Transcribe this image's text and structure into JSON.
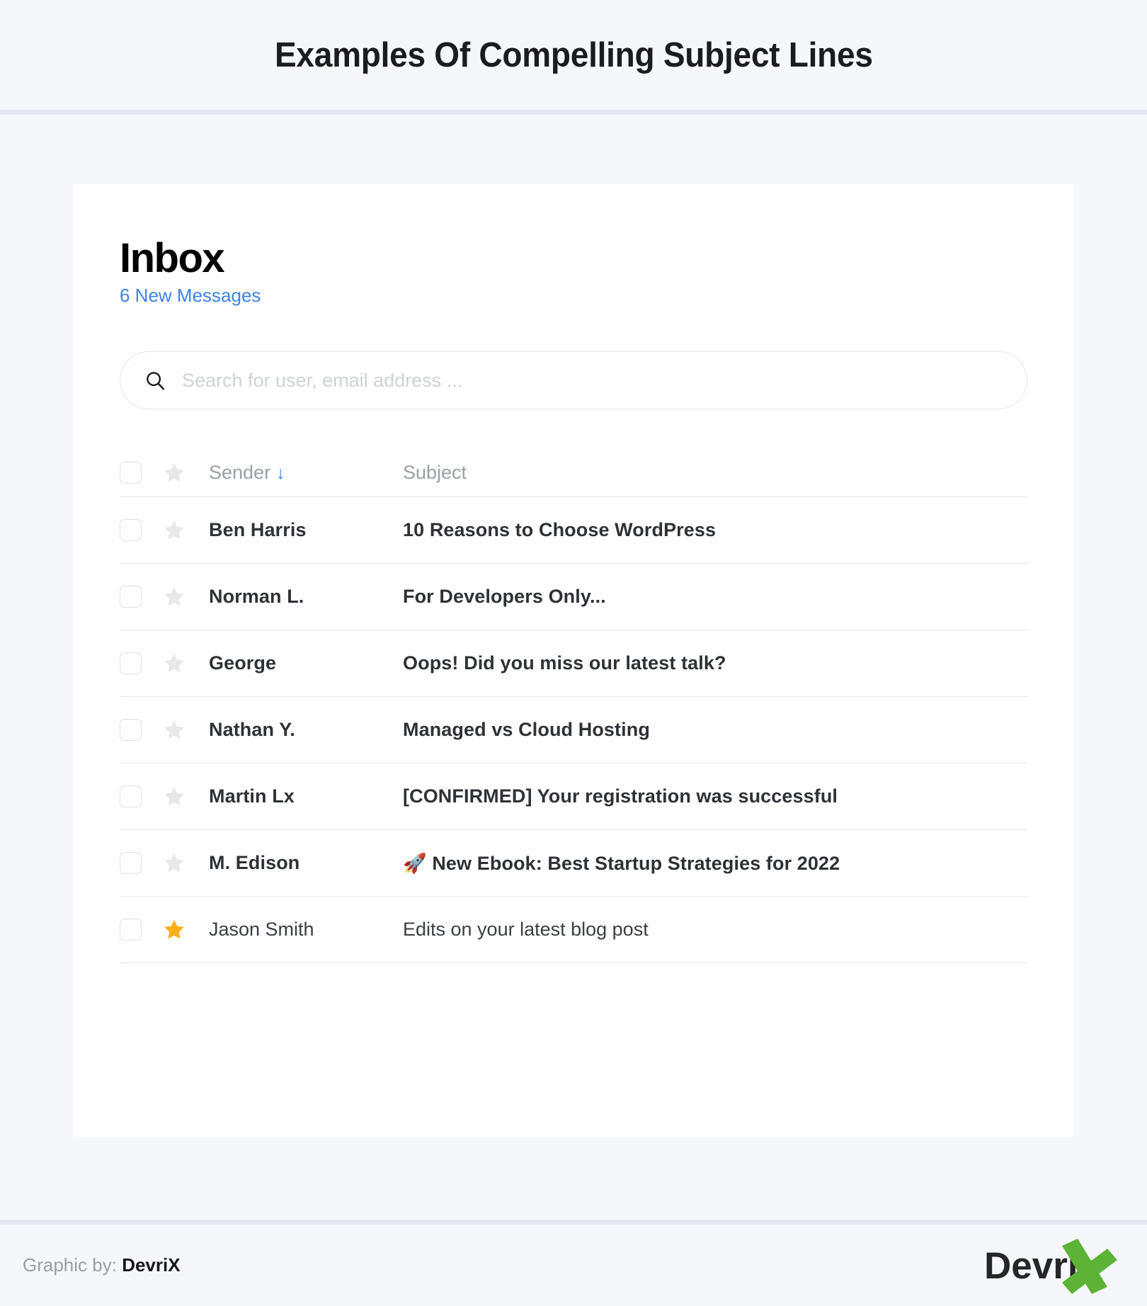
{
  "header": {
    "title": "Examples Of Compelling Subject Lines"
  },
  "inbox": {
    "heading": "Inbox",
    "new_messages": "6 New Messages",
    "accent_color": "#3d83e4"
  },
  "search": {
    "placeholder": "Search for user, email address ...",
    "value": "",
    "icon": "search-icon"
  },
  "table": {
    "columns": {
      "select_all": "",
      "star": "star-icon",
      "sender": "Sender",
      "sort_indicator": "↓",
      "subject": "Subject"
    },
    "rows": [
      {
        "sender": "Ben Harris",
        "subject": "10 Reasons to Choose WordPress",
        "starred": false,
        "unread": true,
        "checked": false
      },
      {
        "sender": "Norman L.",
        "subject": "For Developers Only...",
        "starred": false,
        "unread": true,
        "checked": false
      },
      {
        "sender": "George",
        "subject": "Oops! Did you miss our latest talk?",
        "starred": false,
        "unread": true,
        "checked": false
      },
      {
        "sender": "Nathan Y.",
        "subject": "Managed vs Cloud Hosting",
        "starred": false,
        "unread": true,
        "checked": false
      },
      {
        "sender": "Martin Lx",
        "subject": "[CONFIRMED] Your registration was successful",
        "starred": false,
        "unread": true,
        "checked": false
      },
      {
        "sender": "M. Edison",
        "subject": "🚀 New Ebook: Best Startup Strategies for 2022",
        "starred": false,
        "unread": true,
        "checked": false
      },
      {
        "sender": "Jason Smith",
        "subject": "Edits on your latest blog post",
        "starred": true,
        "unread": false,
        "checked": false
      }
    ]
  },
  "footer": {
    "credit_prefix": "Graphic by:",
    "credit_brand": "DevriX",
    "logo_text": "Devri",
    "logo_mark": "X",
    "logo_mark_color": "#5cb335"
  },
  "colors": {
    "page_background": "#f5f7fb",
    "card_background": "#ffffff",
    "divider": "#e4e7f2",
    "row_divider": "#e4e6ea",
    "star_inactive": "#e6e8ec",
    "star_active": "#fcb016",
    "muted_text": "#9aa0a6",
    "placeholder": "#cfd2d6"
  }
}
